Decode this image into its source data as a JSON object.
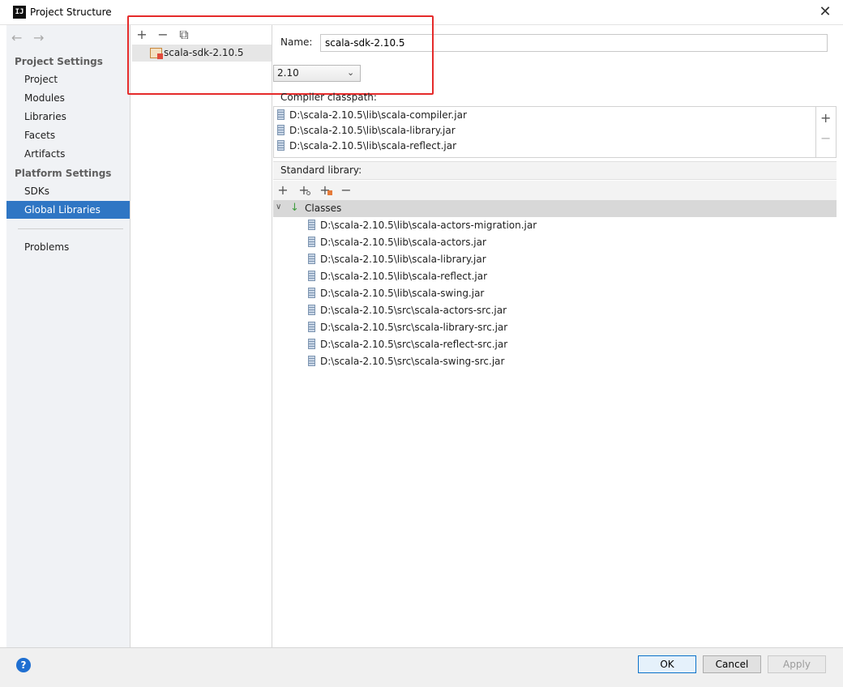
{
  "window": {
    "title": "Project Structure",
    "app_icon": "IJ",
    "close_glyph": "✕"
  },
  "nav": {
    "back_glyph": "←",
    "forward_glyph": "→",
    "project_settings_header": "Project Settings",
    "project_items": [
      "Project",
      "Modules",
      "Libraries",
      "Facets",
      "Artifacts"
    ],
    "platform_settings_header": "Platform Settings",
    "platform_items": [
      "SDKs",
      "Global Libraries"
    ],
    "selected_item": "Global Libraries",
    "problems": "Problems"
  },
  "libraries": {
    "toolbar": {
      "add": "+",
      "remove": "−",
      "copy": "⧉"
    },
    "items": [
      "scala-sdk-2.10.5"
    ]
  },
  "detail": {
    "name_label": "Name:",
    "name_value": "scala-sdk-2.10.5",
    "version_value": "2.10",
    "compiler_classpath_label": "Compiler classpath:",
    "compiler_classpath": [
      "D:\\scala-2.10.5\\lib\\scala-compiler.jar",
      "D:\\scala-2.10.5\\lib\\scala-library.jar",
      "D:\\scala-2.10.5\\lib\\scala-reflect.jar"
    ],
    "classpath_add": "+",
    "classpath_remove": "−",
    "standard_library_label": "Standard library:",
    "std_toolbar": {
      "add": "+",
      "add_alt": "+",
      "add_attach": "+",
      "remove": "−"
    },
    "classes_toggle": "∨",
    "classes_label": "Classes",
    "classes": [
      "D:\\scala-2.10.5\\lib\\scala-actors-migration.jar",
      "D:\\scala-2.10.5\\lib\\scala-actors.jar",
      "D:\\scala-2.10.5\\lib\\scala-library.jar",
      "D:\\scala-2.10.5\\lib\\scala-reflect.jar",
      "D:\\scala-2.10.5\\lib\\scala-swing.jar",
      "D:\\scala-2.10.5\\src\\scala-actors-src.jar",
      "D:\\scala-2.10.5\\src\\scala-library-src.jar",
      "D:\\scala-2.10.5\\src\\scala-reflect-src.jar",
      "D:\\scala-2.10.5\\src\\scala-swing-src.jar"
    ]
  },
  "footer": {
    "help": "?",
    "ok": "OK",
    "cancel": "Cancel",
    "apply": "Apply"
  },
  "colors": {
    "selection": "#2f76c4",
    "highlight_box": "#e52b2b",
    "help": "#1f6fd1"
  }
}
